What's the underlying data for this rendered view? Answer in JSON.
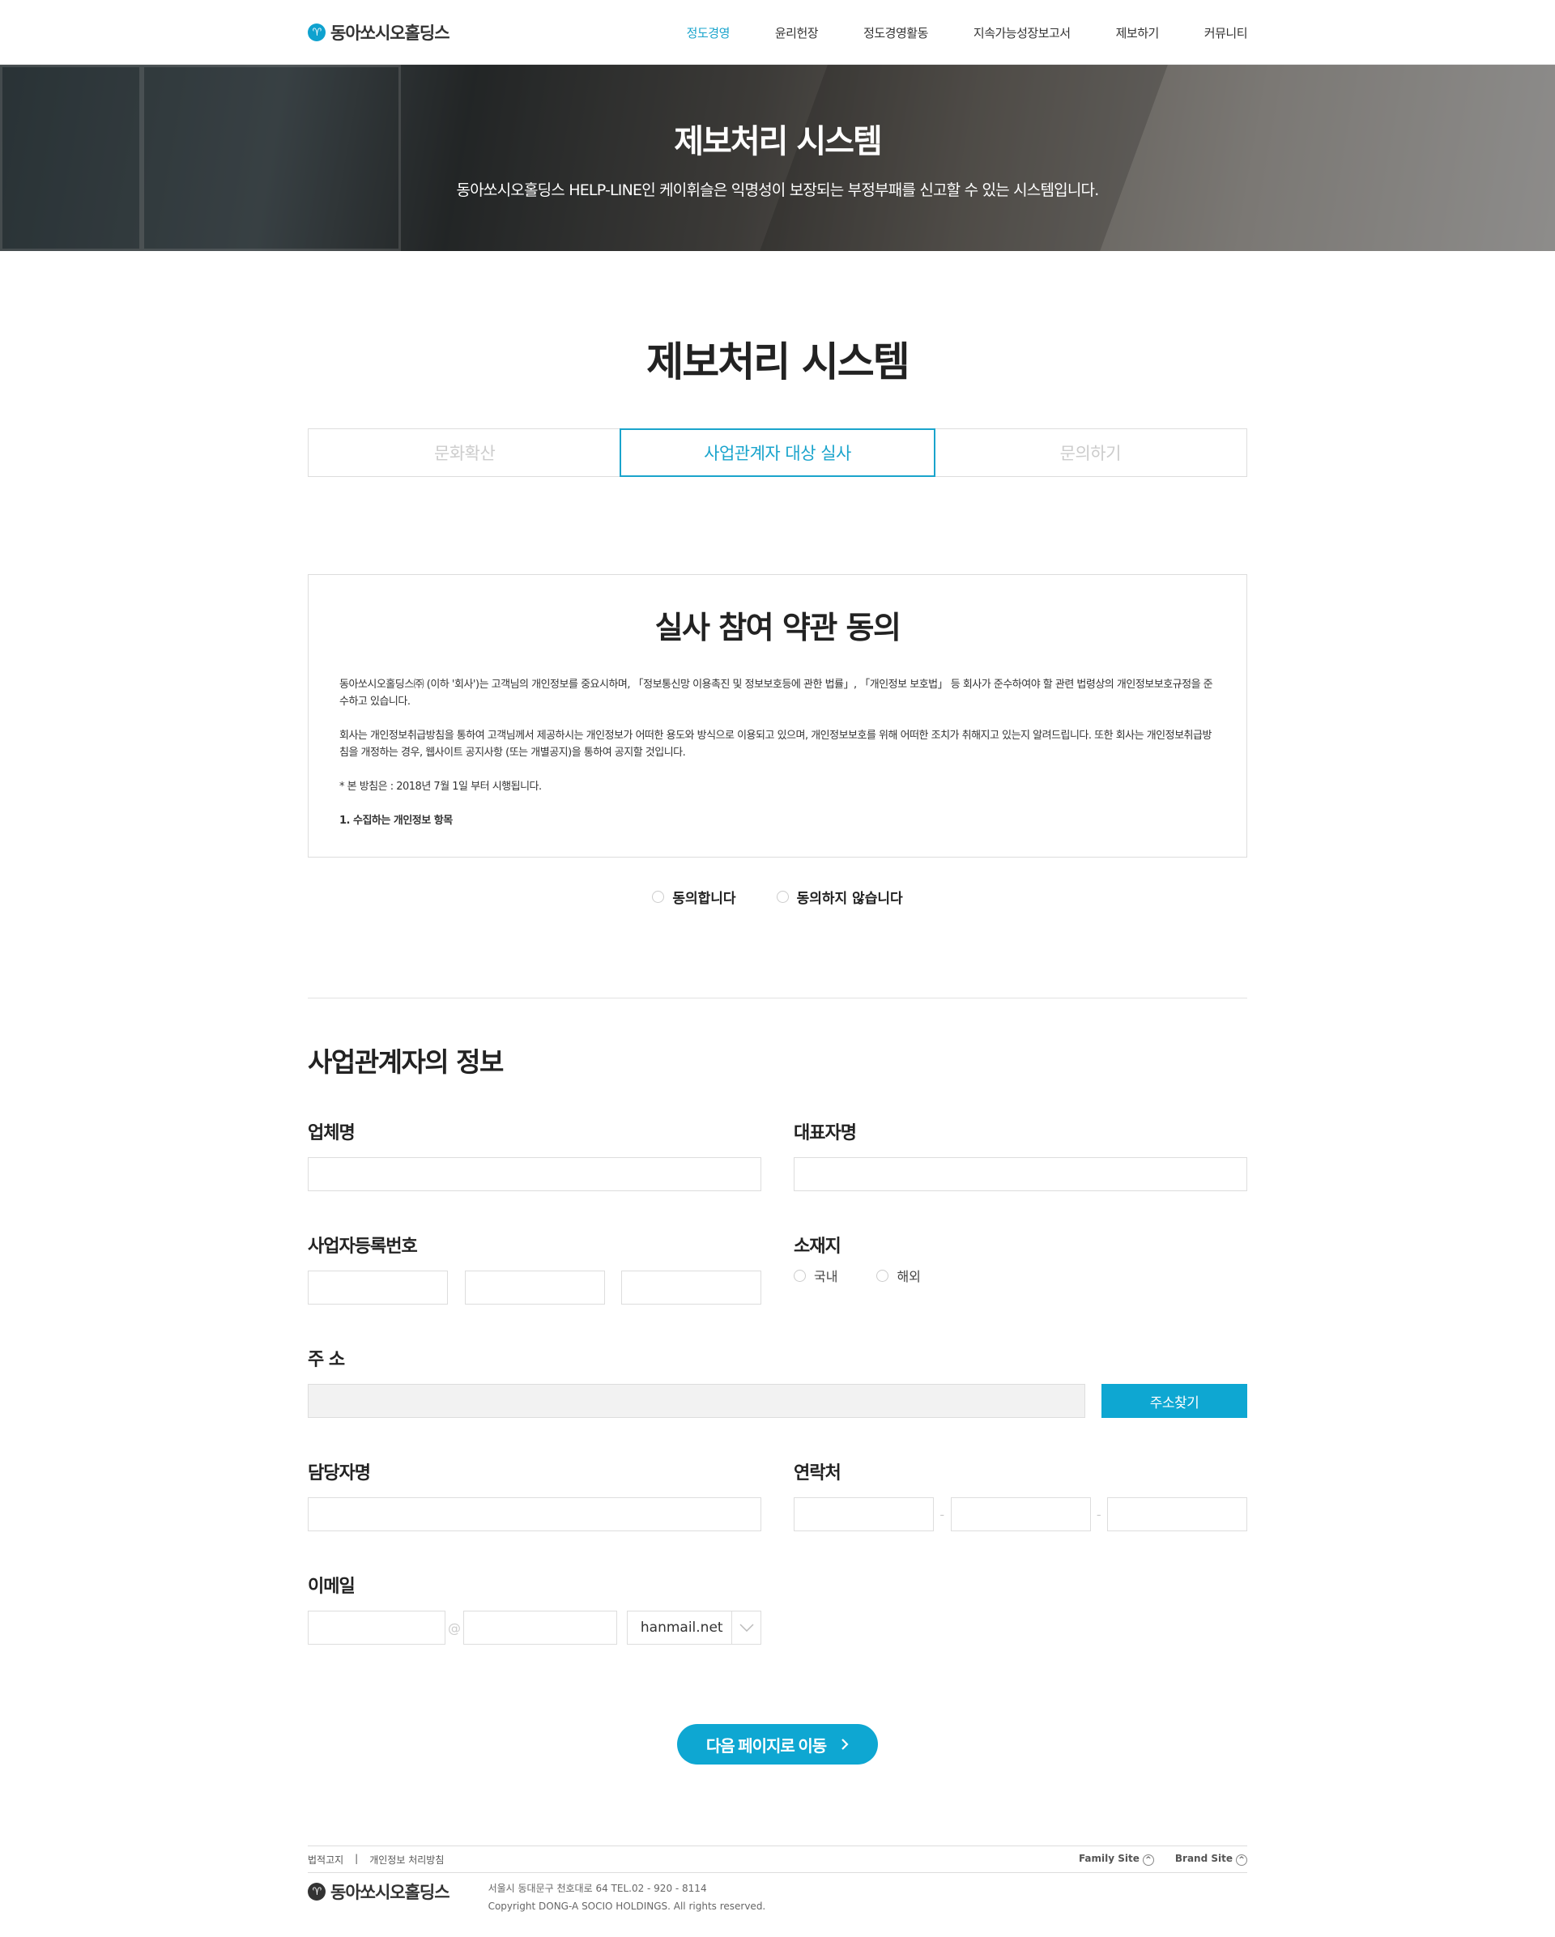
{
  "header": {
    "logo_text": "동아쏘시오홀딩스",
    "logo_mark": "♈",
    "nav": [
      {
        "label": "정도경영",
        "active": true
      },
      {
        "label": "윤리헌장",
        "active": false
      },
      {
        "label": "정도경영활동",
        "active": false
      },
      {
        "label": "지속가능성장보고서",
        "active": false
      },
      {
        "label": "제보하기",
        "active": false
      },
      {
        "label": "커뮤니티",
        "active": false
      }
    ]
  },
  "visual": {
    "title": "제보처리 시스템",
    "subtitle": "동아쏘시오홀딩스 HELP-LINE인 케이휘슬은 익명성이 보장되는 부정부패를 신고할 수 있는 시스템입니다."
  },
  "page_title": "제보처리 시스템",
  "tabs": [
    {
      "label": "문화확산",
      "active": false
    },
    {
      "label": "사업관계자 대상 실사",
      "active": true
    },
    {
      "label": "문의하기",
      "active": false
    }
  ],
  "terms": {
    "title": "실사 참여 약관 동의",
    "paragraphs": [
      "동아쏘시오홀딩스㈜ (이하 '회사')는 고객님의 개인정보를 중요시하며, 「정보통신망 이용촉진 및 정보보호등에 관한 법률」, 「개인정보 보호법」 등 회사가 준수하여야 할 관련 법령상의 개인정보보호규정을 준수하고 있습니다.",
      "회사는 개인정보취급방침을 통하여 고객님께서 제공하시는 개인정보가 어떠한 용도와 방식으로 이용되고 있으며, 개인정보보호를 위해 어떠한 조치가 취해지고 있는지 알려드립니다. 또한 회사는 개인정보취급방침을 개정하는 경우, 웹사이트 공지사항 (또는 개별공지)을 통하여 공지할 것입니다.",
      "* 본 방침은 : 2018년 7월 1일 부터 시행됩니다."
    ],
    "item1": "1. 수집하는 개인정보 항목"
  },
  "agree": {
    "yes": "동의합니다",
    "no": "동의하지 않습니다"
  },
  "form": {
    "section_title": "사업관계자의 정보",
    "company_label": "업체명",
    "ceo_label": "대표자명",
    "biz_no_label": "사업자등록번호",
    "location_label": "소재지",
    "location_domestic": "국내",
    "location_overseas": "해외",
    "address_label": "주 소",
    "address_button": "주소찾기",
    "manager_label": "담당자명",
    "contact_label": "연락처",
    "contact_sep": "-",
    "email_label": "이메일",
    "email_at": "@",
    "email_domain_selected": "hanmail.net",
    "next_button": "다음 페이지로 이동"
  },
  "footer": {
    "legal": "법적고지",
    "divider": "|",
    "privacy": "개인정보 처리방침",
    "family_site": "Family Site",
    "brand_site": "Brand Site",
    "logo_text": "동아쏘시오홀딩스",
    "address": "서울시 동대문구 천호대로 64    TEL.02 - 920 - 8114",
    "copyright": "Copyright DONG-A SOCIO HOLDINGS. All rights reserved."
  }
}
